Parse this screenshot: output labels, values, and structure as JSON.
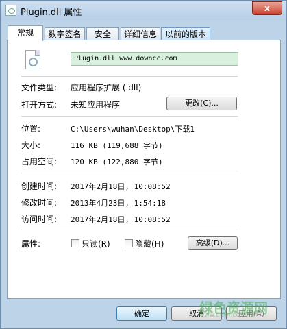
{
  "window": {
    "title": "Plugin.dll 属性",
    "close_label": "x"
  },
  "tabs": [
    {
      "label": "常规"
    },
    {
      "label": "数字签名"
    },
    {
      "label": "安全"
    },
    {
      "label": "详细信息"
    },
    {
      "label": "以前的版本"
    }
  ],
  "general": {
    "filename": "Plugin.dll   www.downcc.com",
    "file_type_label": "文件类型:",
    "file_type_value": "应用程序扩展 (.dll)",
    "open_with_label": "打开方式:",
    "open_with_value": "未知应用程序",
    "change_button": "更改(C)...",
    "location_label": "位置:",
    "location_value": "C:\\Users\\wuhan\\Desktop\\下载1",
    "size_label": "大小:",
    "size_value": "116 KB (119,688 字节)",
    "disk_size_label": "占用空间:",
    "disk_size_value": "120 KB (122,880 字节)",
    "created_label": "创建时间:",
    "created_value": "2017年2月18日, 10:08:52",
    "modified_label": "修改时间:",
    "modified_value": "2013年4月23日, 1:54:18",
    "accessed_label": "访问时间:",
    "accessed_value": "2017年2月18日, 10:08:52",
    "attributes_label": "属性:",
    "readonly_label": "只读(R)",
    "readonly_checked": false,
    "hidden_label": "隐藏(H)",
    "hidden_checked": false,
    "advanced_button": "高级(D)..."
  },
  "footer": {
    "ok": "确定",
    "cancel": "取消",
    "apply": "应用(A)"
  },
  "watermark": {
    "text": "绿色资源网",
    "url": "www.downcc.com"
  }
}
